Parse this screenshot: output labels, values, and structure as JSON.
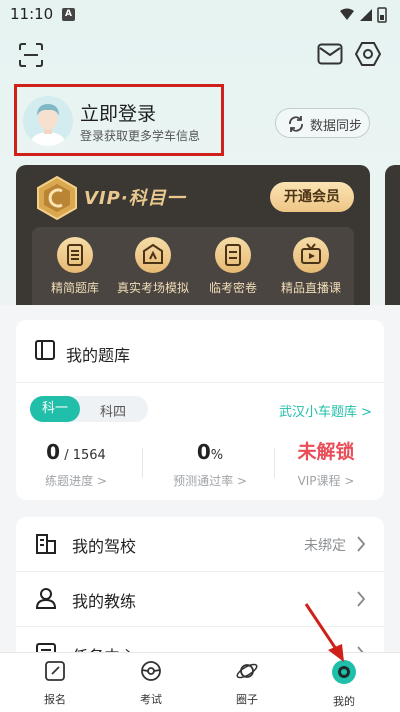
{
  "status_bar": {
    "time": "11:10",
    "sim_label": "A"
  },
  "profile": {
    "title": "立即登录",
    "subtitle": "登录获取更多学车信息"
  },
  "sync_button": {
    "label": "数据同步"
  },
  "vip": {
    "title": "VIP·科目一",
    "button": "开通会员",
    "features": [
      {
        "label": "精简题库",
        "icon": "list-icon"
      },
      {
        "label": "真实考场模拟",
        "icon": "exam-icon"
      },
      {
        "label": "临考密卷",
        "icon": "paper-icon"
      },
      {
        "label": "精品直播课",
        "icon": "live-tv-icon"
      }
    ]
  },
  "question_bank": {
    "title": "我的题库",
    "tabs": [
      "科一",
      "科四"
    ],
    "active_tab": "科一",
    "bank_link": "武汉小车题库 >",
    "stats": {
      "progress_value": "0",
      "progress_total": " / 1564",
      "progress_label": "练题进度 >",
      "pass_rate_value": "0",
      "pass_rate_unit": "%",
      "pass_rate_label": "预测通过率 >",
      "vip_value": "未解锁",
      "vip_label": "VIP课程 >"
    }
  },
  "menu": {
    "items": [
      {
        "label": "我的驾校",
        "value": "未绑定",
        "icon": "building-icon"
      },
      {
        "label": "我的教练",
        "value": "",
        "icon": "person-icon"
      },
      {
        "label": "任务中心",
        "value": "",
        "icon": "task-icon"
      }
    ]
  },
  "bottom_nav": {
    "items": [
      {
        "label": "报名",
        "icon": "edit-icon"
      },
      {
        "label": "考试",
        "icon": "steering-wheel-icon"
      },
      {
        "label": "圈子",
        "icon": "planet-icon"
      },
      {
        "label": "我的",
        "icon": "profile-icon"
      }
    ],
    "active": "我的"
  },
  "colors": {
    "accent": "#21bfa9",
    "vip_gold": "#e9c98f",
    "alert_red": "#e94d57",
    "highlight_box": "#d0201a"
  }
}
